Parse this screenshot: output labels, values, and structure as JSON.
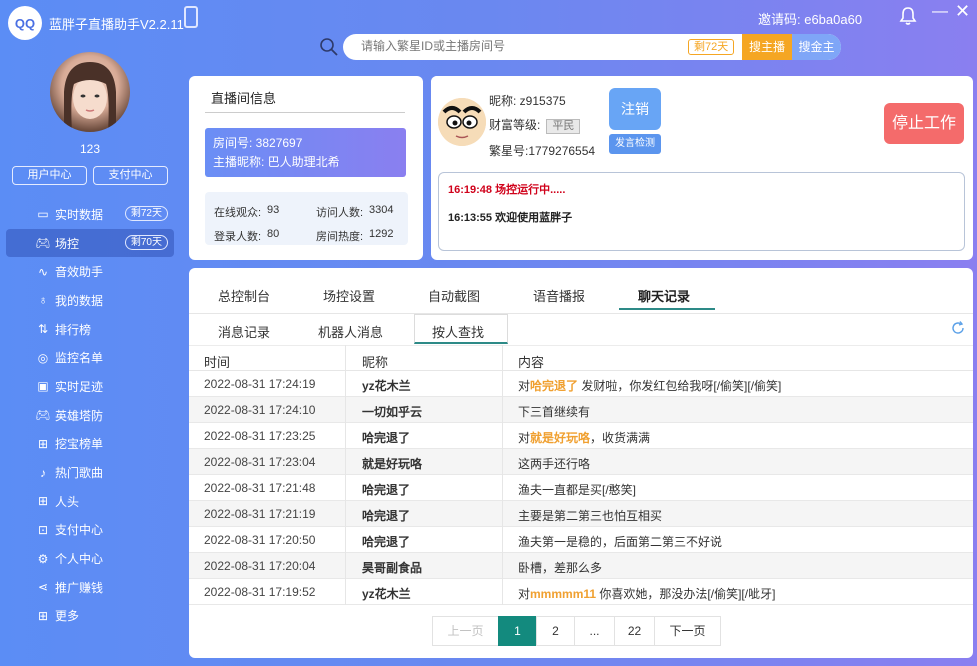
{
  "app": {
    "logo_text": "QQ",
    "title": "蓝胖子直播助手V2.2.11",
    "invite": "邀请码: e6ba0a60"
  },
  "search": {
    "placeholder": "请输入繁星ID或主播房间号",
    "days_tag": "剩72天",
    "anchor_button": "搜主播",
    "gold_button": "搜金主"
  },
  "profile": {
    "uid": "123",
    "user_center": "用户中心",
    "pay_center": "支付中心"
  },
  "sidebar": {
    "items": [
      {
        "label": "实时数据",
        "badge": "剩72天",
        "icon": "monitor-icon"
      },
      {
        "label": "场控",
        "badge": "剩70天",
        "icon": "gamepad-icon",
        "active": true
      },
      {
        "label": "音效助手",
        "icon": "music-wave-icon"
      },
      {
        "label": "我的数据",
        "icon": "microphone-icon"
      },
      {
        "label": "排行榜",
        "icon": "sort-icon"
      },
      {
        "label": "监控名单",
        "icon": "webcam-icon"
      },
      {
        "label": "实时足迹",
        "icon": "footprint-icon"
      },
      {
        "label": "英雄塔防",
        "icon": "gamepad-icon"
      },
      {
        "label": "挖宝榜单",
        "icon": "gift-icon"
      },
      {
        "label": "热门歌曲",
        "icon": "note-icon"
      },
      {
        "label": "人头",
        "icon": "gift-icon"
      },
      {
        "label": "支付中心",
        "icon": "bag-icon"
      },
      {
        "label": "个人中心",
        "icon": "gear-icon"
      },
      {
        "label": "推广赚钱",
        "icon": "share-icon"
      },
      {
        "label": "更多",
        "icon": "grid-icon"
      }
    ]
  },
  "room": {
    "title": "直播间信息",
    "room_no": "房间号: 3827697",
    "anchor_nick": "主播昵称: 巴人助理北希",
    "online_label": "在线观众:",
    "online_value": "93",
    "visits_label": "访问人数:",
    "visits_value": "3304",
    "logged_label": "登录人数:",
    "logged_value": "80",
    "heat_label": "房间热度:",
    "heat_value": "1292"
  },
  "user": {
    "nickname": "昵称:  z915375",
    "wealth_label": "财富等级:",
    "wealth_value": "平民",
    "fanxing_no": "繁星号:1779276554",
    "logout_button": "注销",
    "check_button": "发言检测",
    "stop_button": "停止工作"
  },
  "logs": [
    {
      "text": "16:19:48 场控运行中.....",
      "color": "#d0021b"
    },
    {
      "text": "16:13:55 欢迎使用蓝胖子",
      "color": "#222222"
    }
  ],
  "tabs_main": [
    "总控制台",
    "场控设置",
    "自动截图",
    "语音播报",
    "聊天记录"
  ],
  "tabs_sub": [
    "消息记录",
    "机器人消息",
    "按人查找"
  ],
  "table": {
    "headers": [
      "时间",
      "昵称",
      "内容"
    ],
    "rows": [
      {
        "time": "2022-08-31 17:24:19",
        "nick": "yz花木兰",
        "pre": "对",
        "hl": "哈完退了",
        "post": " 发财啦，你发红包给我呀[/偷笑][/偷笑]"
      },
      {
        "time": "2022-08-31 17:24:10",
        "nick": "一切如乎云",
        "pre": "下三首继续有",
        "hl": "",
        "post": ""
      },
      {
        "time": "2022-08-31 17:23:25",
        "nick": "哈完退了",
        "pre": "对",
        "hl": "就是好玩咯",
        "post": "，收货满满"
      },
      {
        "time": "2022-08-31 17:23:04",
        "nick": "就是好玩咯",
        "pre": "这两手还行咯",
        "hl": "",
        "post": ""
      },
      {
        "time": "2022-08-31 17:21:48",
        "nick": "哈完退了",
        "pre": "渔夫一直都是买[/憨笑]",
        "hl": "",
        "post": ""
      },
      {
        "time": "2022-08-31 17:21:19",
        "nick": "哈完退了",
        "pre": "主要是第二第三也怕互相买",
        "hl": "",
        "post": ""
      },
      {
        "time": "2022-08-31 17:20:50",
        "nick": "哈完退了",
        "pre": "渔夫第一是稳的，后面第二第三不好说",
        "hl": "",
        "post": ""
      },
      {
        "time": "2022-08-31 17:20:04",
        "nick": "昊哥副食品",
        "pre": "卧槽，差那么多",
        "hl": "",
        "post": ""
      },
      {
        "time": "2022-08-31 17:19:52",
        "nick": "yz花木兰",
        "pre": "对",
        "hl": "mmmmm11",
        "post": " 你喜欢她，那没办法[/偷笑][/呲牙]"
      }
    ]
  },
  "pager": {
    "prev": "上一页",
    "pages": [
      "1",
      "2",
      "...",
      "22"
    ],
    "next": "下一页"
  }
}
